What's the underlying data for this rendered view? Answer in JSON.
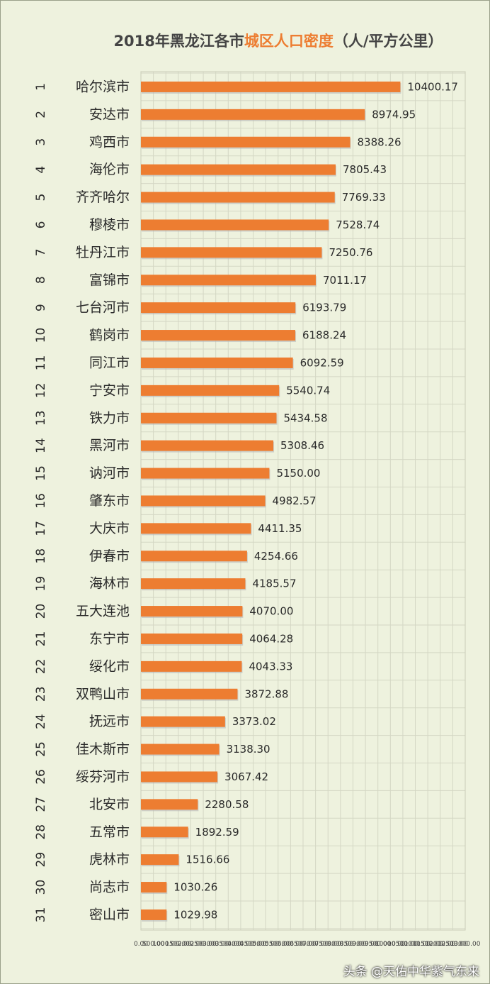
{
  "chart_data": {
    "type": "bar",
    "orientation": "horizontal",
    "title": "2018年黑龙江各市城区人口密度（人/平方公里）",
    "title_parts": [
      "2018年黑龙江各市",
      "城区人口密度",
      "（人/平方公里）"
    ],
    "categories": [
      "哈尔滨市",
      "安达市",
      "鸡西市",
      "海伦市",
      "齐齐哈尔",
      "穆棱市",
      "牡丹江市",
      "富锦市",
      "七台河市",
      "鹤岗市",
      "同江市",
      "宁安市",
      "铁力市",
      "黑河市",
      "讷河市",
      "肇东市",
      "大庆市",
      "伊春市",
      "海林市",
      "五大连池",
      "东宁市",
      "绥化市",
      "双鸭山市",
      "抚远市",
      "佳木斯市",
      "绥芬河市",
      "北安市",
      "五常市",
      "虎林市",
      "尚志市",
      "密山市"
    ],
    "ranks": [
      "1",
      "2",
      "3",
      "4",
      "5",
      "6",
      "7",
      "8",
      "9",
      "10",
      "11",
      "12",
      "13",
      "14",
      "15",
      "16",
      "17",
      "18",
      "19",
      "20",
      "21",
      "22",
      "23",
      "24",
      "25",
      "26",
      "27",
      "28",
      "29",
      "30",
      "31"
    ],
    "values": [
      10400.17,
      8974.95,
      8388.26,
      7805.43,
      7769.33,
      7528.74,
      7250.76,
      7011.17,
      6193.79,
      6188.24,
      6092.59,
      5540.74,
      5434.58,
      5308.46,
      5150.0,
      4982.57,
      4411.35,
      4254.66,
      4185.57,
      4070.0,
      4064.28,
      4043.33,
      3872.88,
      3373.02,
      3138.3,
      3067.42,
      2280.58,
      1892.59,
      1516.66,
      1030.26,
      1029.98
    ],
    "value_labels": [
      "10400.17",
      "8974.95",
      "8388.26",
      "7805.43",
      "7769.33",
      "7528.74",
      "7250.76",
      "7011.17",
      "6193.79",
      "6188.24",
      "6092.59",
      "5540.74",
      "5434.58",
      "5308.46",
      "5150.00",
      "4982.57",
      "4411.35",
      "4254.66",
      "4185.57",
      "4070.00",
      "4064.28",
      "4043.33",
      "3872.88",
      "3373.02",
      "3138.30",
      "3067.42",
      "2280.58",
      "1892.59",
      "1516.66",
      "1030.26",
      "1029.98"
    ],
    "xlim": [
      0,
      13000
    ],
    "x_ticks": [
      "0.00",
      "500.00",
      "1000.00",
      "1500.00",
      "2000.00",
      "2500.00",
      "3000.00",
      "3500.00",
      "4000.00",
      "4500.00",
      "5000.00",
      "5500.00",
      "6000.00",
      "6500.00",
      "7000.00",
      "7500.00",
      "8000.00",
      "8500.00",
      "9000.00",
      "9500.00",
      "10000.00",
      "10500.00",
      "11000.00",
      "11500.00",
      "12000.00",
      "12500.00",
      "13000.00"
    ],
    "grid": true,
    "colors": {
      "bar": "#ed7d31",
      "background": "#eef2de",
      "grid": "#d4d7c4",
      "title_highlight": "#ed7d31"
    }
  },
  "watermark": "头条 @天佑中华紫气东来"
}
